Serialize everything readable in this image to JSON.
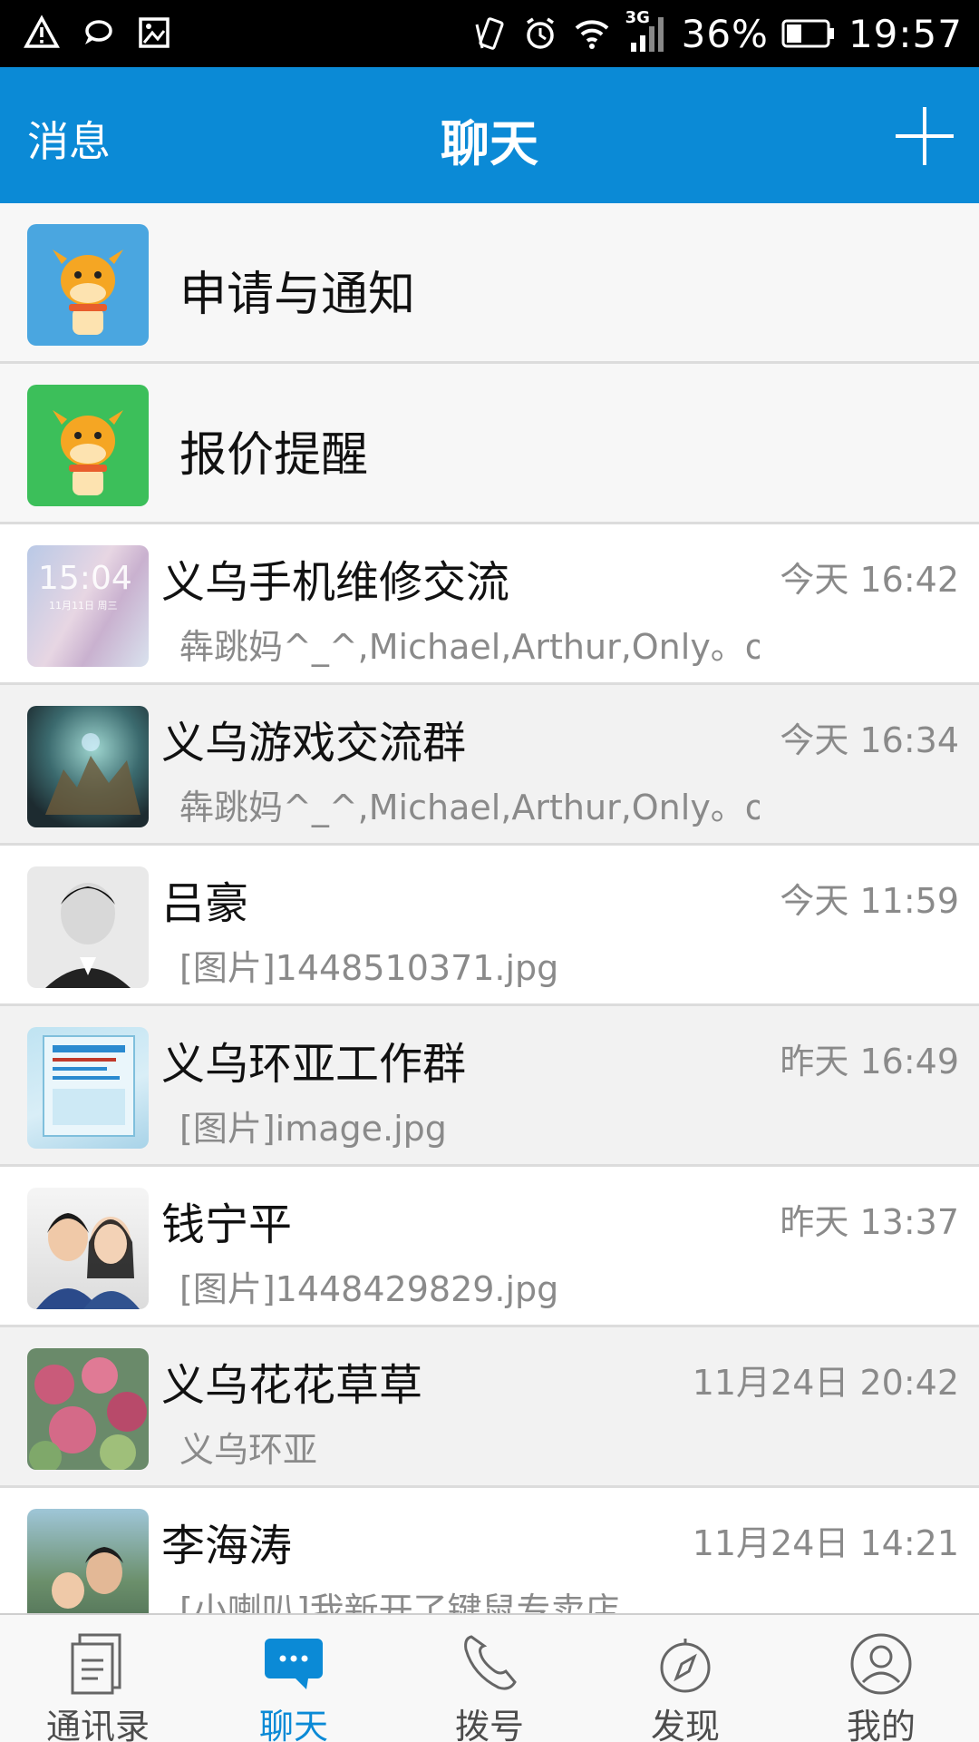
{
  "status_bar": {
    "battery": "36%",
    "time": "19:57",
    "network": "3G",
    "icons": [
      "warning-icon",
      "chat-bubble-icon",
      "image-icon",
      "vibrate-icon",
      "alarm-icon",
      "wifi-icon",
      "signal-icon",
      "battery-icon"
    ]
  },
  "header": {
    "left_label": "消息",
    "title": "聊天",
    "right_icon": "plus-icon"
  },
  "system_rows": [
    {
      "title": "申请与通知",
      "avatar_color": "#4aa6e0"
    },
    {
      "title": "报价提醒",
      "avatar_color": "#3cbf5a"
    }
  ],
  "chats": [
    {
      "name": "义乌手机维修交流",
      "time": "今天 16:42",
      "preview": "犇跳妈^_^,Michael,Arthur,Only。o..."
    },
    {
      "name": "义乌游戏交流群",
      "time": "今天 16:34",
      "preview": "犇跳妈^_^,Michael,Arthur,Only。o..."
    },
    {
      "name": "吕豪",
      "time": "今天 11:59",
      "preview": "[图片]1448510371.jpg"
    },
    {
      "name": "义乌环亚工作群",
      "time": "昨天 16:49",
      "preview": "[图片]image.jpg"
    },
    {
      "name": "钱宁平",
      "time": "昨天 13:37",
      "preview": "[图片]1448429829.jpg"
    },
    {
      "name": "义乌花花草草",
      "time": "11月24日 20:42",
      "preview": "义乌环亚"
    },
    {
      "name": "李海涛",
      "time": "11月24日 14:21",
      "preview": "[小喇叭]我新开了键鼠专卖店"
    }
  ],
  "avatar1_text": {
    "time": "15:04",
    "date": "11月11日 周三"
  },
  "bottom_nav": [
    {
      "label": "通讯录",
      "icon": "contacts-icon"
    },
    {
      "label": "聊天",
      "icon": "chat-icon",
      "active": true
    },
    {
      "label": "拨号",
      "icon": "phone-icon"
    },
    {
      "label": "发现",
      "icon": "compass-icon"
    },
    {
      "label": "我的",
      "icon": "profile-icon"
    }
  ],
  "colors": {
    "accent": "#0b8ad6",
    "status_bar": "#000000",
    "muted_text": "#8a8a8a"
  }
}
